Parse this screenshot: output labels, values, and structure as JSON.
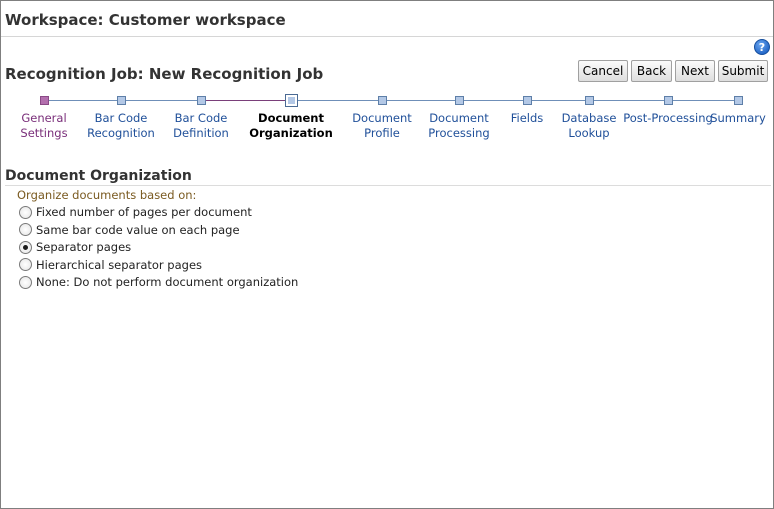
{
  "workspace": {
    "title": "Workspace: Customer workspace"
  },
  "help": {
    "icon": "help-icon",
    "glyph": "?"
  },
  "job": {
    "title": "Recognition Job: New Recognition Job"
  },
  "buttons": {
    "cancel": "Cancel",
    "back": "Back",
    "next": "Next",
    "submit": "Submit"
  },
  "train": {
    "steps": [
      {
        "label": "General\nSettings",
        "state": "visited"
      },
      {
        "label": "Bar Code\nRecognition",
        "state": "unvisited"
      },
      {
        "label": "Bar Code\nDefinition",
        "state": "unvisited"
      },
      {
        "label": "Document\nOrganization",
        "state": "current"
      },
      {
        "label": "Document\nProfile",
        "state": "unvisited"
      },
      {
        "label": "Document\nProcessing",
        "state": "unvisited"
      },
      {
        "label": "Fields",
        "state": "unvisited"
      },
      {
        "label": "Database\nLookup",
        "state": "unvisited"
      },
      {
        "label": "Post-Processing",
        "state": "unvisited"
      },
      {
        "label": "Summary",
        "state": "unvisited"
      }
    ]
  },
  "section": {
    "title": "Document Organization",
    "group_label": "Organize documents based on:",
    "options": [
      {
        "label": "Fixed number of pages per document",
        "checked": false
      },
      {
        "label": "Same bar code value on each page",
        "checked": false
      },
      {
        "label": "Separator pages",
        "checked": true
      },
      {
        "label": "Hierarchical separator pages",
        "checked": false
      },
      {
        "label": "None: Do not perform document organization",
        "checked": false
      }
    ]
  },
  "colors": {
    "link": "#1f4f99",
    "visited": "#7a2f7a",
    "group_label": "#7a5a20"
  }
}
